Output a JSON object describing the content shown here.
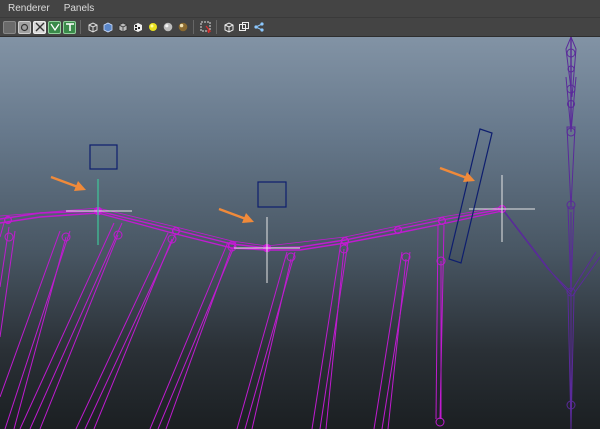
{
  "menubar": {
    "items": [
      {
        "label": "Renderer"
      },
      {
        "label": "Panels"
      }
    ]
  },
  "toolbar": {
    "icons": [
      "select-camera-icon",
      "snapshot-icon",
      "grid-icon",
      "wireframe-toggle-icon",
      "texture-text-icon",
      "wireframe-cube-icon",
      "smooth-shade-cube-icon",
      "wireframe-on-shaded-icon",
      "checker-texture-icon",
      "default-light-icon",
      "all-lights-sphere-icon",
      "shadows-sphere-icon",
      "isolate-select-icon",
      "xray-cube-icon",
      "xray-joints-icon",
      "share-icon"
    ]
  },
  "viewport": {
    "colors": {
      "bone": "#c01bd0",
      "joint": "#d21ee0",
      "rig_dark": "#5a2a9a",
      "locator": "#e6e6e6",
      "control_box": "#0e1e6e",
      "annotation_arrow": "#f08a3a",
      "selected_axis": "#3ec89a"
    }
  }
}
